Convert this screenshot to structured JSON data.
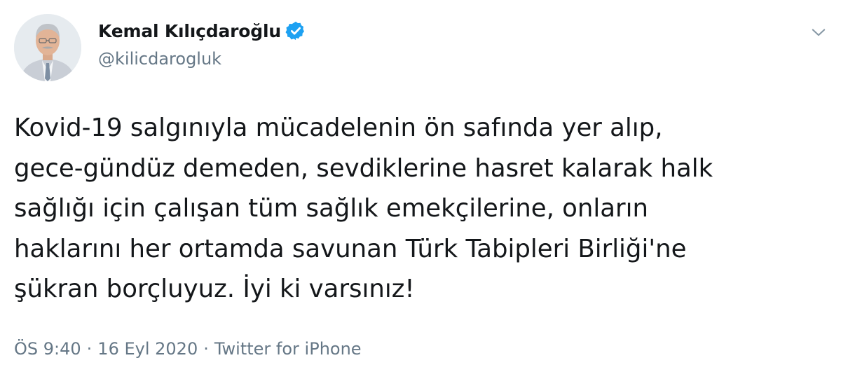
{
  "author": {
    "display_name": "Kemal Kılıçdaroğlu",
    "handle": "@kilicdarogluk",
    "verified": true,
    "avatar_icon": "profile-photo"
  },
  "tweet": {
    "lines": [
      "Kovid-19 salgınıyla mücadelenin ön safında yer alıp,",
      "gece-gündüz demeden, sevdiklerine hasret kalarak halk",
      "sağlığı için çalışan tüm sağlık emekçilerine, onların",
      "haklarını her ortamda savunan Türk Tabipleri Birliği'ne",
      "şükran borçluyuz. İyi ki varsınız!"
    ]
  },
  "meta": {
    "time": "ÖS 9:40",
    "separator": "·",
    "date": "16 Eyl 2020",
    "source": "Twitter for iPhone"
  },
  "icons": {
    "verified": "verified-badge-icon",
    "more": "chevron-down-icon"
  },
  "colors": {
    "text": "#14171a",
    "secondary": "#657786",
    "verified_blue": "#1da1f2",
    "background": "#ffffff"
  }
}
